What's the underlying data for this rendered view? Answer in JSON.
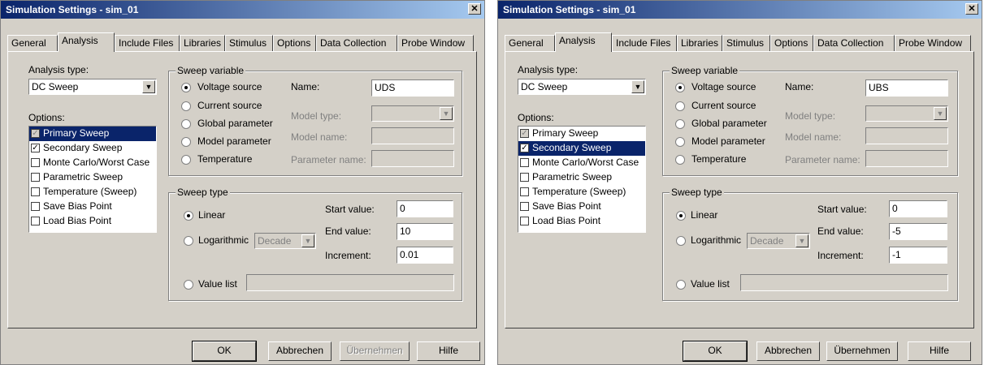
{
  "left": {
    "title": "Simulation Settings - sim_01",
    "tabs": [
      "General",
      "Analysis",
      "Include Files",
      "Libraries",
      "Stimulus",
      "Options",
      "Data Collection",
      "Probe Window"
    ],
    "analysis_type_label": "Analysis type:",
    "analysis_type_value": "DC Sweep",
    "options_label": "Options:",
    "options": [
      {
        "label": "Primary Sweep",
        "checked": "✓"
      },
      {
        "label": "Secondary Sweep",
        "checked": "✓"
      },
      {
        "label": "Monte Carlo/Worst Case",
        "checked": ""
      },
      {
        "label": "Parametric Sweep",
        "checked": ""
      },
      {
        "label": "Temperature (Sweep)",
        "checked": ""
      },
      {
        "label": "Save Bias Point",
        "checked": ""
      },
      {
        "label": "Load Bias Point",
        "checked": ""
      }
    ],
    "sweep_variable": {
      "group_label": "Sweep variable",
      "voltage_source": "Voltage source",
      "current_source": "Current source",
      "global_parameter": "Global parameter",
      "model_parameter": "Model parameter",
      "temperature": "Temperature",
      "name_label": "Name:",
      "name_value": "UDS",
      "model_type_label": "Model type:",
      "model_name_label": "Model name:",
      "parameter_name_label": "Parameter name:"
    },
    "sweep_type": {
      "group_label": "Sweep type",
      "linear": "Linear",
      "logarithmic": "Logarithmic",
      "log_scale": "Decade",
      "start_label": "Start value:",
      "start_value": "0",
      "end_label": "End value:",
      "end_value": "10",
      "increment_label": "Increment:",
      "increment_value": "0.01",
      "value_list": "Value list"
    },
    "buttons": {
      "ok": "OK",
      "cancel": "Abbrechen",
      "apply": "Übernehmen",
      "help": "Hilfe"
    }
  },
  "right": {
    "title": "Simulation Settings - sim_01",
    "tabs": [
      "General",
      "Analysis",
      "Include Files",
      "Libraries",
      "Stimulus",
      "Options",
      "Data Collection",
      "Probe Window"
    ],
    "analysis_type_label": "Analysis type:",
    "analysis_type_value": "DC Sweep",
    "options_label": "Options:",
    "options": [
      {
        "label": "Primary Sweep",
        "checked": "✓"
      },
      {
        "label": "Secondary Sweep",
        "checked": "✓"
      },
      {
        "label": "Monte Carlo/Worst Case",
        "checked": ""
      },
      {
        "label": "Parametric Sweep",
        "checked": ""
      },
      {
        "label": "Temperature (Sweep)",
        "checked": ""
      },
      {
        "label": "Save Bias Point",
        "checked": ""
      },
      {
        "label": "Load Bias Point",
        "checked": ""
      }
    ],
    "sweep_variable": {
      "group_label": "Sweep variable",
      "voltage_source": "Voltage source",
      "current_source": "Current source",
      "global_parameter": "Global parameter",
      "model_parameter": "Model parameter",
      "temperature": "Temperature",
      "name_label": "Name:",
      "name_value": "UBS",
      "model_type_label": "Model type:",
      "model_name_label": "Model name:",
      "parameter_name_label": "Parameter name:"
    },
    "sweep_type": {
      "group_label": "Sweep type",
      "linear": "Linear",
      "logarithmic": "Logarithmic",
      "log_scale": "Decade",
      "start_label": "Start value:",
      "start_value": "0",
      "end_label": "End value:",
      "end_value": "-5",
      "increment_label": "Increment:",
      "increment_value": "-1",
      "value_list": "Value list"
    },
    "buttons": {
      "ok": "OK",
      "cancel": "Abbrechen",
      "apply": "Übernehmen",
      "help": "Hilfe"
    }
  }
}
